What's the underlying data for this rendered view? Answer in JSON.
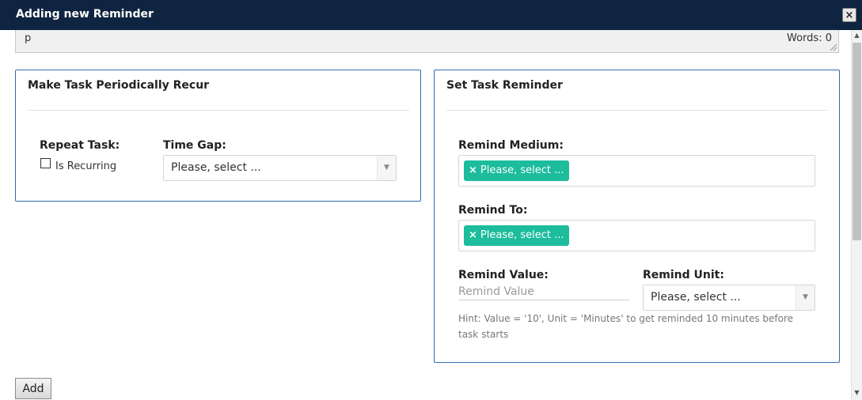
{
  "dialog": {
    "title": "Adding new Reminder",
    "close_label": "×"
  },
  "editor": {
    "path": "p",
    "word_count": "Words: 0"
  },
  "recur_panel": {
    "title": "Make Task Periodically Recur",
    "repeat_label": "Repeat Task:",
    "checkbox_label": "Is Recurring",
    "is_recurring": false,
    "time_gap_label": "Time Gap:",
    "time_gap_value": "Please, select ..."
  },
  "reminder_panel": {
    "title": "Set Task Reminder",
    "medium_label": "Remind Medium:",
    "medium_chip": "Please, select ...",
    "to_label": "Remind To:",
    "to_chip": "Please, select ...",
    "chip_remove": "×",
    "value_label": "Remind Value:",
    "value_placeholder": "Remind Value",
    "unit_label": "Remind Unit:",
    "unit_value": "Please, select ...",
    "hint": "Hint: Value = '10', Unit = 'Minutes' to get reminded 10 minutes before task starts"
  },
  "footer": {
    "add_label": "Add"
  },
  "icons": {
    "dropdown": "▼",
    "scroll_up": "▲",
    "scroll_down": "▼"
  },
  "colors": {
    "titlebar": "#0f2440",
    "panel_border": "#2f6db1",
    "chip": "#1cbc9c"
  }
}
